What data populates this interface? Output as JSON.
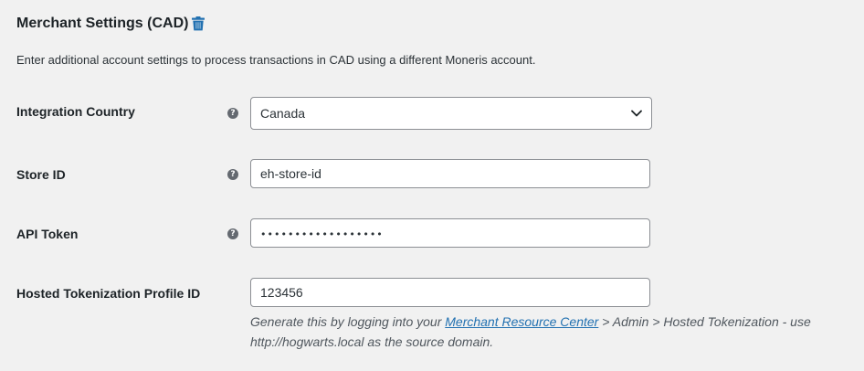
{
  "section": {
    "title": "Merchant Settings (CAD)",
    "description": "Enter additional account settings to process transactions in CAD using a different Moneris account."
  },
  "fields": {
    "integration_country": {
      "label": "Integration Country",
      "value": "Canada"
    },
    "store_id": {
      "label": "Store ID",
      "value": "eh-store-id"
    },
    "api_token": {
      "label": "API Token",
      "value": "••••••••••••••••••"
    },
    "hosted_tokenization": {
      "label": "Hosted Tokenization Profile ID",
      "value": "123456",
      "help_prefix": "Generate this by logging into your ",
      "help_link": "Merchant Resource Center",
      "help_suffix": " > Admin > Hosted Tokenization - use http://hogwarts.local as the source domain."
    }
  },
  "icons": {
    "help": "question-mark-circle",
    "delete": "trash-icon",
    "dropdown": "chevron-down"
  },
  "colors": {
    "link": "#2271b1",
    "trash": "#2271b1",
    "background": "#f1f1f1"
  }
}
